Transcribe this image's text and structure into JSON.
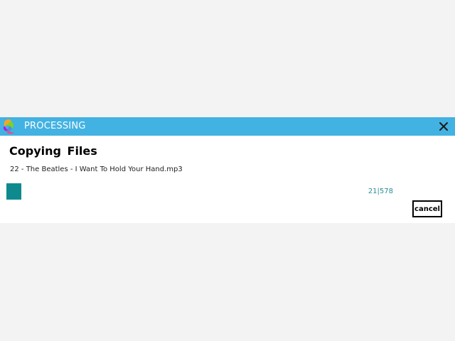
{
  "window": {
    "title": "PROCESSING",
    "accent_color": "#42b2e2",
    "close_icon": "close-icon",
    "logo_icon": "app-logo-icon"
  },
  "dialog": {
    "heading": "Copying  Files",
    "current_file": "22 - The Beatles - I Want To Hold Your Hand.mp3",
    "progress": {
      "current": 21,
      "total": 578,
      "label": "21|578",
      "fill_color": "#0e8a8f"
    },
    "cancel_label": "cancel"
  }
}
